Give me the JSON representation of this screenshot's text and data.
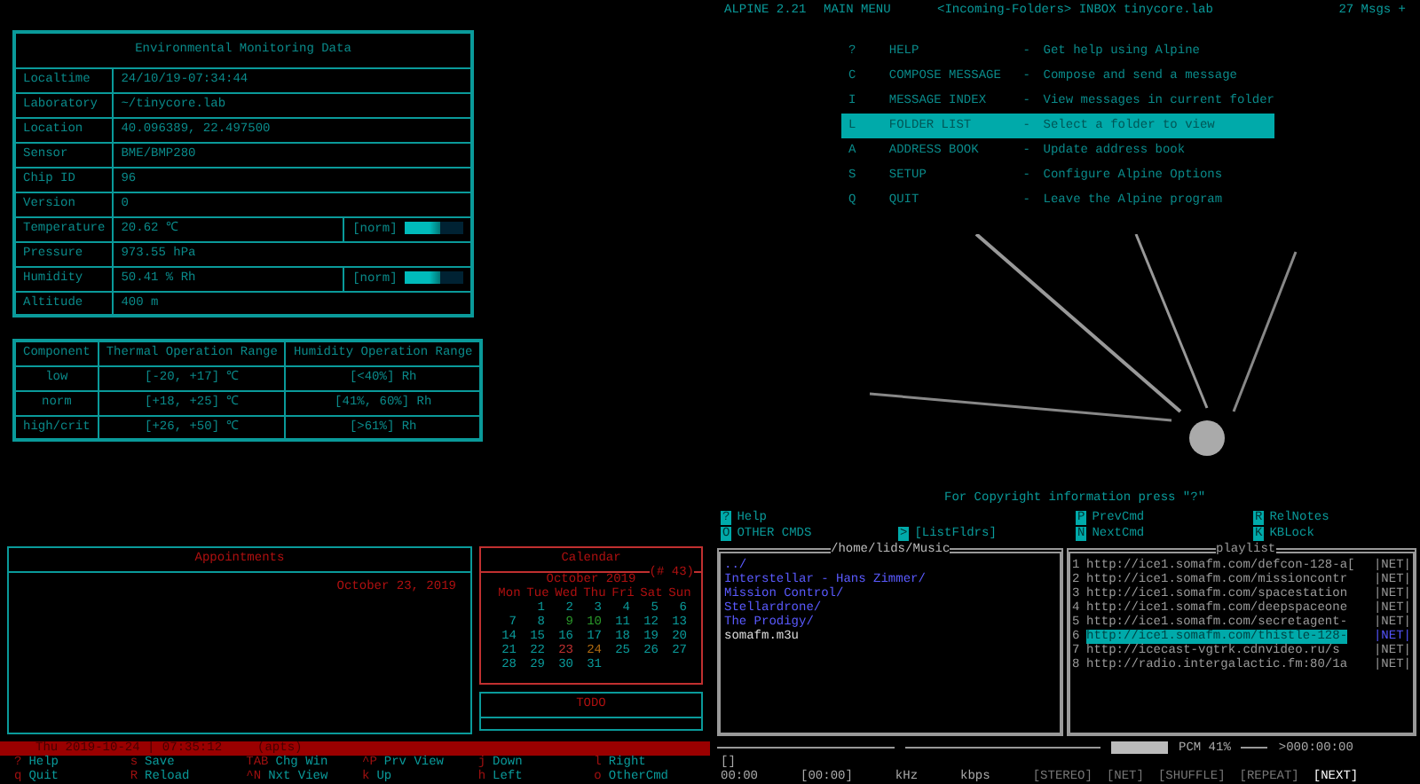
{
  "env_table": {
    "title": "Environmental Monitoring Data",
    "rows": [
      {
        "label": "Localtime",
        "value": "24/10/19-07:34:44"
      },
      {
        "label": "Laboratory",
        "value": "~/tinycore.lab"
      },
      {
        "label": "Location",
        "value": "40.096389, 22.497500"
      },
      {
        "label": "Sensor",
        "value": "BME/BMP280"
      },
      {
        "label": "Chip ID",
        "value": "96"
      },
      {
        "label": "Version",
        "value": "0"
      },
      {
        "label": "Temperature",
        "value": "20.62 ℃",
        "status": "[norm]",
        "level": 0.6
      },
      {
        "label": "Pressure",
        "value": "973.55 hPa"
      },
      {
        "label": "Humidity",
        "value": "50.41 % Rh",
        "status": "[norm]",
        "level": 0.6
      },
      {
        "label": "Altitude",
        "value": "400 m"
      }
    ]
  },
  "range_table": {
    "columns": [
      "Component",
      "Thermal Operation Range",
      "Humidity Operation Range"
    ],
    "rows": [
      [
        "low",
        "[-20, +17] ℃",
        "[<40%] Rh"
      ],
      [
        "norm",
        "[+18, +25] ℃",
        "[41%, 60%] Rh"
      ],
      [
        "high/crit",
        "[+26, +50] ℃",
        "[>61%] Rh"
      ]
    ]
  },
  "appointments": {
    "title": "Appointments",
    "date": "October 23, 2019"
  },
  "calendar": {
    "title": "Calendar",
    "week": "(# 43)",
    "month": "October 2019",
    "weekdays": [
      "Mon",
      "Tue",
      "Wed",
      "Thu",
      "Fri",
      "Sat",
      "Sun"
    ],
    "weeks": [
      [
        {
          "day": "1",
          "color": "#0a9a9a"
        },
        {
          "day": "2",
          "color": "#0a9a9a"
        },
        {
          "day": "3",
          "color": "#0a9a9a"
        },
        {
          "day": "4",
          "color": "#0a9a9a"
        },
        {
          "day": "5",
          "color": "#0a9a9a"
        },
        {
          "day": "6",
          "color": "#0a9a9a"
        }
      ],
      [
        {
          "day": "7",
          "color": "#0a9a9a"
        },
        {
          "day": "8",
          "color": "#0a9a9a"
        },
        {
          "day": "9",
          "color": "#2a9a2a"
        },
        {
          "day": "10",
          "color": "#2a9a2a"
        },
        {
          "day": "11",
          "color": "#0a9a9a"
        },
        {
          "day": "12",
          "color": "#0a9a9a"
        },
        {
          "day": "13",
          "color": "#0a9a9a"
        }
      ],
      [
        {
          "day": "14",
          "color": "#0a9a9a"
        },
        {
          "day": "15",
          "color": "#0a9a9a"
        },
        {
          "day": "16",
          "color": "#0a9a9a"
        },
        {
          "day": "17",
          "color": "#0a9a9a"
        },
        {
          "day": "18",
          "color": "#0a9a9a"
        },
        {
          "day": "19",
          "color": "#0a9a9a"
        },
        {
          "day": "20",
          "color": "#0a9a9a"
        }
      ],
      [
        {
          "day": "21",
          "color": "#0a9a9a"
        },
        {
          "day": "22",
          "color": "#0a9a9a"
        },
        {
          "day": "23",
          "color": "#c03030"
        },
        {
          "day": "24",
          "color": "#b06a10"
        },
        {
          "day": "25",
          "color": "#0a9a9a"
        },
        {
          "day": "26",
          "color": "#0a9a9a"
        },
        {
          "day": "27",
          "color": "#0a9a9a"
        }
      ],
      [
        {
          "day": "28",
          "color": "#0a9a9a"
        },
        {
          "day": "29",
          "color": "#0a9a9a"
        },
        {
          "day": "30",
          "color": "#0a9a9a"
        },
        {
          "day": "31",
          "color": "#0a9a9a"
        }
      ]
    ]
  },
  "todo": {
    "title": "TODO"
  },
  "status_bar": {
    "date_time": "Thu 2019-10-24 | 07:35:12",
    "mode": "(apts)"
  },
  "keys": [
    {
      "key": "?",
      "label": "Help"
    },
    {
      "key": "s",
      "label": "Save"
    },
    {
      "key": "TAB",
      "label": "Chg Win"
    },
    {
      "key": "^P",
      "label": "Prv View"
    },
    {
      "key": "j",
      "label": "Down"
    },
    {
      "key": "l",
      "label": "Right"
    },
    {
      "key": "q",
      "label": "Quit"
    },
    {
      "key": "R",
      "label": "Reload"
    },
    {
      "key": "^N",
      "label": "Nxt View"
    },
    {
      "key": "k",
      "label": "Up"
    },
    {
      "key": "h",
      "label": "Left"
    },
    {
      "key": "o",
      "label": "OtherCmd"
    }
  ],
  "alpine": {
    "title": "ALPINE 2.21",
    "screen": "MAIN MENU",
    "folder": "<Incoming-Folders> INBOX tinycore.lab",
    "count": "27 Msgs +",
    "menu": [
      {
        "key": "?",
        "command": "HELP",
        "dash": "-",
        "description": "Get help using Alpine",
        "selected": false
      },
      {
        "key": "C",
        "command": "COMPOSE MESSAGE",
        "dash": "-",
        "description": "Compose and send a message",
        "selected": false
      },
      {
        "key": "I",
        "command": "MESSAGE INDEX",
        "dash": "-",
        "description": "View messages in current folder",
        "selected": false
      },
      {
        "key": "L",
        "command": "FOLDER LIST",
        "dash": "-",
        "description": "Select a folder to view",
        "selected": true
      },
      {
        "key": "A",
        "command": "ADDRESS BOOK",
        "dash": "-",
        "description": "Update address book",
        "selected": false
      },
      {
        "key": "S",
        "command": "SETUP",
        "dash": "-",
        "description": "Configure Alpine Options",
        "selected": false
      },
      {
        "key": "Q",
        "command": "QUIT",
        "dash": "-",
        "description": "Leave the Alpine program",
        "selected": false
      }
    ],
    "copyright": "For Copyright information press \"?\"",
    "commands": [
      {
        "key": "?",
        "label": "Help"
      },
      {
        "key": "P",
        "label": "PrevCmd"
      },
      {
        "key": "R",
        "label": "RelNotes"
      },
      {
        "key": "O",
        "label": "OTHER CMDS"
      },
      {
        "key": ">",
        "label": "[ListFldrs]"
      },
      {
        "key": "N",
        "label": "NextCmd"
      },
      {
        "key": "K",
        "label": "KBLock"
      }
    ]
  },
  "file_browser": {
    "path": "/home/lids/Music",
    "items": [
      {
        "name": "../",
        "kind": "dir"
      },
      {
        "name": "Interstellar - Hans Zimmer/",
        "kind": "dir"
      },
      {
        "name": "Mission Control/",
        "kind": "dir"
      },
      {
        "name": "Stellardrone/",
        "kind": "dir"
      },
      {
        "name": "The Prodigy/",
        "kind": "dir"
      },
      {
        "name": "somafm.m3u",
        "kind": "file"
      }
    ]
  },
  "playlist": {
    "title": "playlist",
    "items": [
      {
        "number": "1",
        "url": "http://ice1.somafm.com/defcon-128-a[",
        "tag": "|NET|",
        "selected": false
      },
      {
        "number": "2",
        "url": "http://ice1.somafm.com/missioncontr",
        "tag": "|NET|",
        "selected": false
      },
      {
        "number": "3",
        "url": "http://ice1.somafm.com/spacestation",
        "tag": "|NET|",
        "selected": false
      },
      {
        "number": "4",
        "url": "http://ice1.somafm.com/deepspaceone",
        "tag": "|NET|",
        "selected": false
      },
      {
        "number": "5",
        "url": "http://ice1.somafm.com/secretagent-",
        "tag": "|NET|",
        "selected": false
      },
      {
        "number": "6",
        "url": "http://ice1.somafm.com/thistle-128-",
        "tag": "|NET|",
        "selected": true
      },
      {
        "number": "7",
        "url": "http://icecast-vgtrk.cdnvideo.ru/s",
        "tag": "|NET|",
        "selected": false
      },
      {
        "number": "8",
        "url": "http://radio.intergalactic.fm:80/1a",
        "tag": "|NET|",
        "selected": false
      }
    ]
  },
  "player": {
    "volume": "PCM  41%",
    "end_time": ">000:00:00",
    "state": "[]",
    "time": "00:00",
    "total": "[00:00]",
    "khz": "kHz",
    "kbps": "kbps",
    "flags": [
      {
        "label": "[STEREO]",
        "on": false
      },
      {
        "label": "[NET]",
        "on": false
      },
      {
        "label": "[SHUFFLE]",
        "on": false
      },
      {
        "label": "[REPEAT]",
        "on": false
      },
      {
        "label": "[NEXT]",
        "on": true
      }
    ]
  }
}
